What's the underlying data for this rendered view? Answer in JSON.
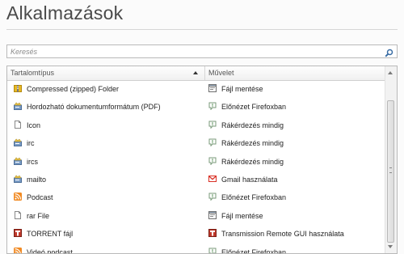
{
  "page": {
    "title": "Alkalmazások"
  },
  "search": {
    "placeholder": "Keresés"
  },
  "table": {
    "headers": {
      "content_type": "Tartalomtípus",
      "action": "Művelet"
    },
    "rows": [
      {
        "content_type": "Compressed (zipped) Folder",
        "type_icon": "zip-folder-icon",
        "action": "Fájl mentése",
        "action_icon": "save-file-icon"
      },
      {
        "content_type": "Hordozható dokumentumformátum (PDF)",
        "type_icon": "document-app-icon",
        "action": "Előnézet Firefoxban",
        "action_icon": "ask-speech-icon"
      },
      {
        "content_type": "Icon",
        "type_icon": "blank-file-icon",
        "action": "Rákérdezés mindig",
        "action_icon": "ask-speech-icon"
      },
      {
        "content_type": "irc",
        "type_icon": "document-app-icon",
        "action": "Rákérdezés mindig",
        "action_icon": "ask-speech-icon"
      },
      {
        "content_type": "ircs",
        "type_icon": "document-app-icon",
        "action": "Rákérdezés mindig",
        "action_icon": "ask-speech-icon"
      },
      {
        "content_type": "mailto",
        "type_icon": "document-app-icon",
        "action": "Gmail használata",
        "action_icon": "gmail-icon"
      },
      {
        "content_type": "Podcast",
        "type_icon": "rss-feed-icon",
        "action": "Előnézet Firefoxban",
        "action_icon": "ask-speech-icon"
      },
      {
        "content_type": "rar File",
        "type_icon": "blank-file-icon",
        "action": "Fájl mentése",
        "action_icon": "save-file-icon"
      },
      {
        "content_type": "TORRENT fájl",
        "type_icon": "torrent-icon",
        "action": "Transmission Remote GUI használata",
        "action_icon": "torrent-icon"
      },
      {
        "content_type": "Videó podcast",
        "type_icon": "rss-feed-icon",
        "action": "Előnézet Firefoxban",
        "action_icon": "ask-speech-icon"
      }
    ]
  },
  "colors": {
    "gmail_red": "#d93025",
    "rss_orange": "#f18a23",
    "zip_yellow": "#e8b923"
  }
}
